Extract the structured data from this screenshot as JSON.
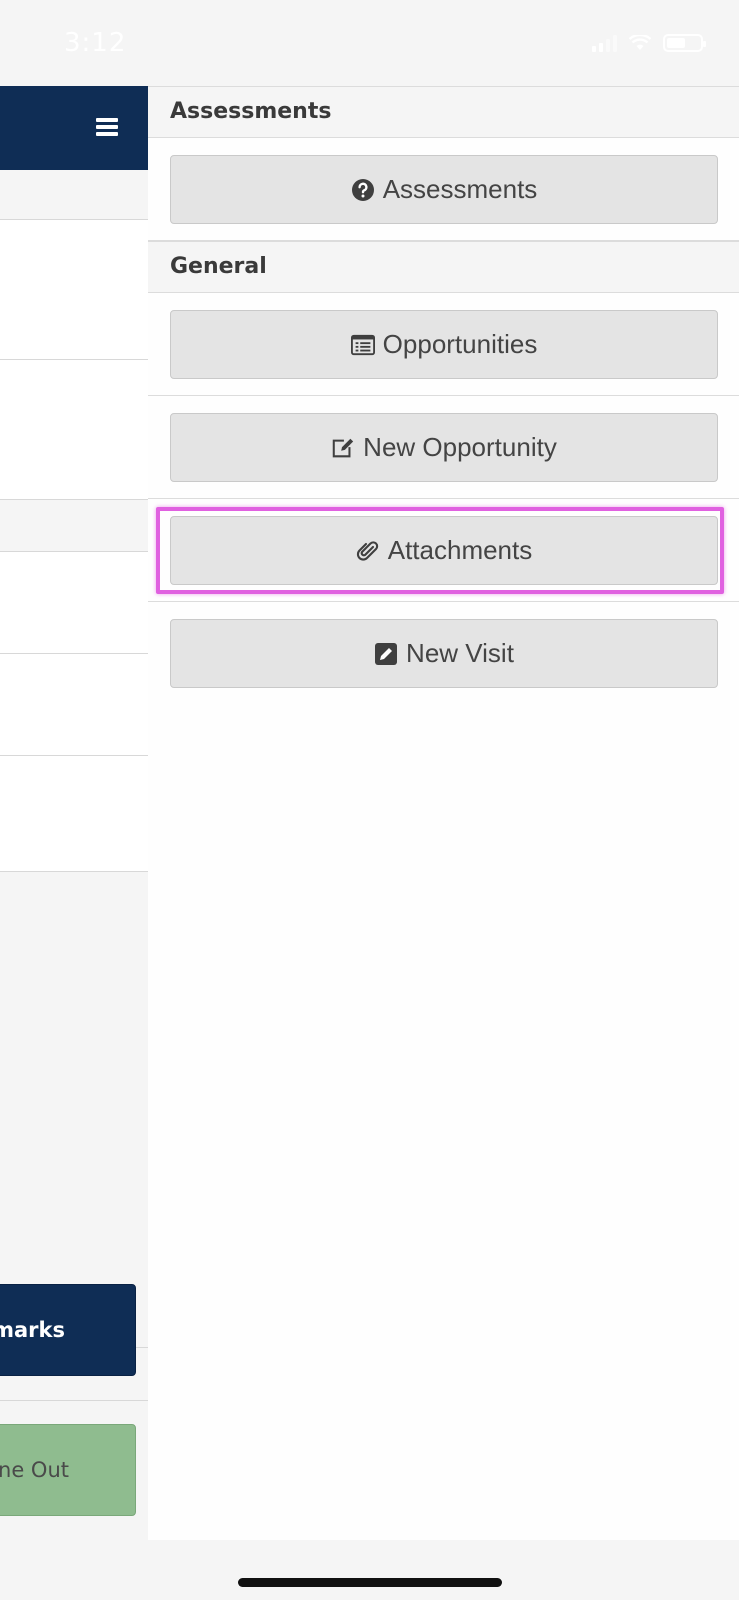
{
  "status_bar": {
    "time": "3:12"
  },
  "left_page": {
    "remarks_button_label": "emarks",
    "time_out_button_label": "ne Out",
    "colors": {
      "header": "#0f2d55",
      "remarks": "#0f2d55",
      "time_out": "#8fbc8f"
    }
  },
  "drawer": {
    "sections": [
      {
        "title": "Assessments",
        "buttons": [
          {
            "label": "Assessments",
            "icon": "question-circle-icon"
          }
        ]
      },
      {
        "title": "General",
        "buttons": [
          {
            "label": "Opportunities",
            "icon": "list-alt-icon"
          },
          {
            "label": "New Opportunity",
            "icon": "edit-icon"
          },
          {
            "label": "Attachments",
            "icon": "paperclip-icon",
            "highlighted": true
          },
          {
            "label": "New Visit",
            "icon": "pencil-square-icon"
          }
        ]
      }
    ],
    "highlight_color": "#e060e0"
  }
}
